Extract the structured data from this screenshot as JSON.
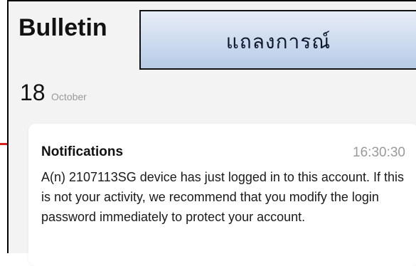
{
  "header": {
    "title": "Bulletin",
    "caption": "แถลงการณ์"
  },
  "date": {
    "day": "18",
    "month": "October"
  },
  "notification": {
    "title": "Notifications",
    "time": "16:30:30",
    "body": "A(n) 2107113SG device has just logged in to this account. If this is not your activity, we recommend that you modify the login password immediately to protect your account."
  },
  "colors": {
    "background": "#f3f3f3",
    "card": "#ffffff",
    "caption_gradient_top": "#e7edf7",
    "caption_gradient_bottom": "#b7cbe6",
    "accent_mark": "#d61f1f",
    "muted_text": "#9a9a9a"
  }
}
